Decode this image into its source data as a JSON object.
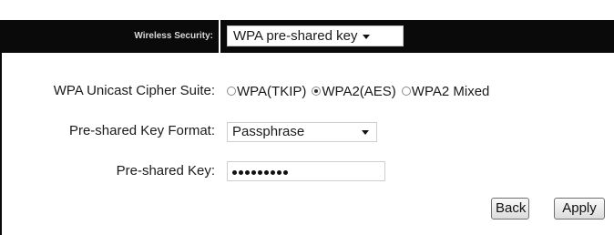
{
  "header": {
    "label": "Wireless Security:",
    "security_mode": "WPA pre-shared key"
  },
  "cipher_suite": {
    "label": "WPA Unicast Cipher Suite:",
    "options": [
      "WPA(TKIP)",
      "WPA2(AES)",
      "WPA2 Mixed"
    ],
    "selected": "WPA2(AES)"
  },
  "key_format": {
    "label": "Pre-shared Key Format:",
    "value": "Passphrase"
  },
  "key": {
    "label": "Pre-shared Key:",
    "masked_length": 9
  },
  "buttons": {
    "back": "Back",
    "apply": "Apply"
  }
}
